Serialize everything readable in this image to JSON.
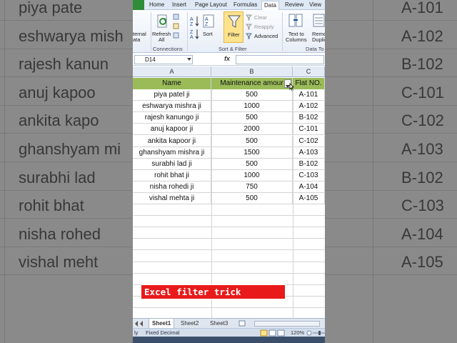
{
  "ribbon": {
    "tabs": [
      "Home",
      "Insert",
      "Page Layout",
      "Formulas",
      "Data",
      "Review",
      "View"
    ],
    "active_tab": "Data",
    "external_label_line1": "ternal",
    "external_label_line2": "ata",
    "refresh_line1": "Refresh",
    "refresh_line2": "All",
    "sort_label": "Sort",
    "filter_label": "Filter",
    "clear_label": "Clear",
    "reapply_label": "Reapply",
    "advanced_label": "Advanced",
    "text_to_col_line1": "Text to",
    "text_to_col_line2": "Columns",
    "remove_line1": "Remo",
    "remove_line2": "Duplic",
    "group_connections": "Connections",
    "group_sortfilter": "Sort & Filter",
    "group_datatools": "Data To"
  },
  "formula_bar": {
    "name_box": "D14",
    "fx": "fx",
    "formula": ""
  },
  "columns": [
    "A",
    "B",
    "C"
  ],
  "table": {
    "headers": [
      "Name",
      "Maintenance amour",
      "Flat NO."
    ],
    "rows": [
      [
        "piya patel ji",
        "500",
        "A-101"
      ],
      [
        "eshwarya mishra ji",
        "1000",
        "A-102"
      ],
      [
        "rajesh kanungo ji",
        "500",
        "B-102"
      ],
      [
        "anuj kapoor ji",
        "2000",
        "C-101"
      ],
      [
        "ankita kapoor ji",
        "500",
        "C-102"
      ],
      [
        "ghanshyam mishra ji",
        "1500",
        "A-103"
      ],
      [
        "surabhi lad ji",
        "500",
        "B-102"
      ],
      [
        "rohit bhat ji",
        "1000",
        "C-103"
      ],
      [
        "nisha rohedi ji",
        "750",
        "A-104"
      ],
      [
        "vishal mehta ji",
        "500",
        "A-105"
      ]
    ]
  },
  "sheets": [
    "Sheet1",
    "Sheet2",
    "Sheet3"
  ],
  "active_sheet": "Sheet1",
  "status": {
    "mode": "ly",
    "fixed_decimal": "Fixed Decimal",
    "zoom": "120%"
  },
  "background": {
    "names": [
      "piya pate",
      "eshwarya mish",
      "rajesh kanun",
      "anuj kapoo",
      "ankita kapo",
      "ghanshyam mi",
      "surabhi lad",
      "rohit bhat",
      "nisha rohed",
      "vishal meht"
    ],
    "flats": [
      "A-101",
      "A-102",
      "B-102",
      "C-101",
      "C-102",
      "A-103",
      "B-102",
      "C-103",
      "A-104",
      "A-105"
    ]
  },
  "overlay": {
    "caption": "Excel filter trick"
  },
  "colors": {
    "header_fill": "#9bbb59",
    "caption_bg": "#e81a1a",
    "file_tab": "#2f8d3a"
  }
}
